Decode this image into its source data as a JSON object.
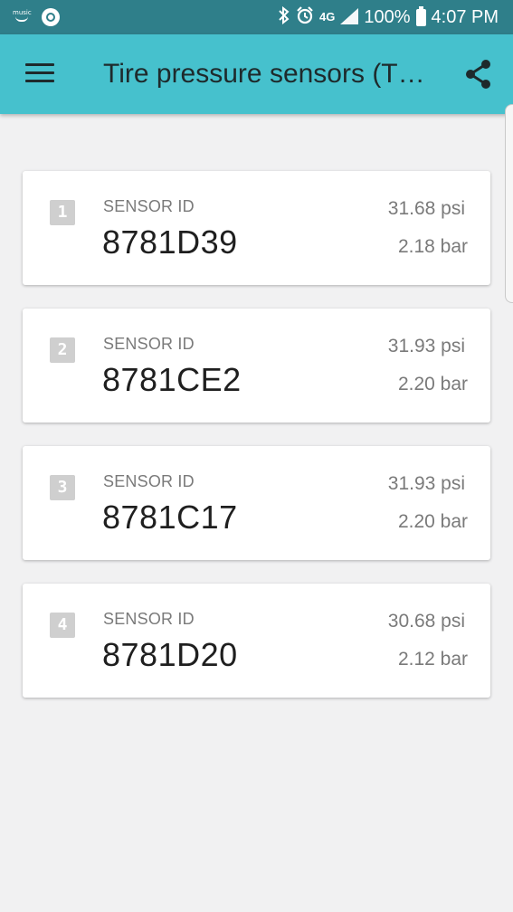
{
  "status_bar": {
    "music_label": "music",
    "battery": "100%",
    "time": "4:07 PM",
    "network": "4G"
  },
  "app_bar": {
    "title": "Tire pressure sensors (T…",
    "menu_icon": "hamburger-menu-icon",
    "share_icon": "share-icon",
    "color": "#46c1cd"
  },
  "sensors": [
    {
      "index": "1",
      "label": "SENSOR ID",
      "id": "8781D39",
      "psi": "31.68 psi",
      "bar": "2.18 bar"
    },
    {
      "index": "2",
      "label": "SENSOR ID",
      "id": "8781CE2",
      "psi": "31.93 psi",
      "bar": "2.20 bar"
    },
    {
      "index": "3",
      "label": "SENSOR ID",
      "id": "8781C17",
      "psi": "31.93 psi",
      "bar": "2.20 bar"
    },
    {
      "index": "4",
      "label": "SENSOR ID",
      "id": "8781D20",
      "psi": "30.68 psi",
      "bar": "2.12 bar"
    }
  ]
}
